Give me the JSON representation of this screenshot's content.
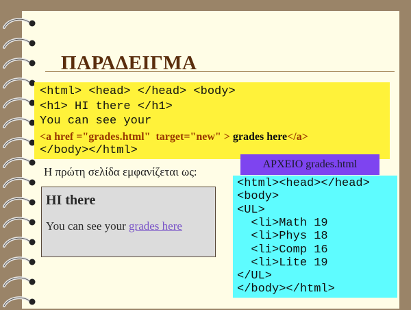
{
  "slide": {
    "title": "ΠΑΡΑΔΕΙΓΜΑ",
    "code_lines": [
      "<html> <head> </head> <body>",
      "<h1> HI there </h1>",
      "You can see your"
    ],
    "anchor_line": {
      "open": "<a href =\"grades.html\"  target=\"new\" >",
      "text": " grades here",
      "close": "</a>"
    },
    "last_line": "</body></html>",
    "lead_text": "Η πρώτη σελίδα εμφανίζεται ως:",
    "file_label": "ΑΡΧΕΙΟ  grades.html"
  },
  "browser_preview": {
    "heading": "HI there",
    "text": "You can see your ",
    "link": "grades here"
  },
  "grades_file": {
    "lines": [
      "<html><head></head>",
      "<body>",
      "<UL>",
      "  <li>Math 19",
      "  <li>Phys 18",
      "  <li>Comp 16",
      "  <li>Lite 19",
      "</UL>",
      "</body></html>"
    ]
  },
  "colors": {
    "background": "#9a8468",
    "page": "#fffde6",
    "code_highlight": "#fff23a",
    "file_label_bg": "#7e44f0",
    "file_code_bg": "#5efcff",
    "link": "#7a55c8"
  }
}
